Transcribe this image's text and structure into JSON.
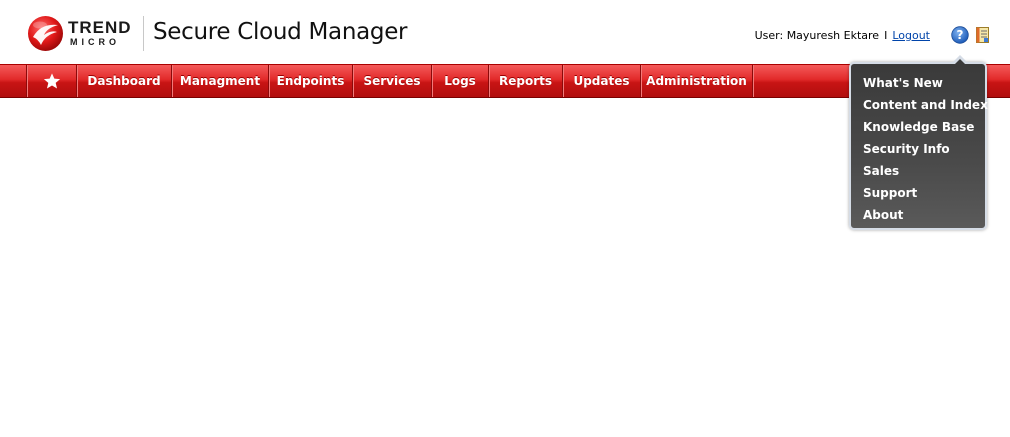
{
  "brand": {
    "logo_trend": "TREND",
    "logo_micro": "MICRO",
    "product_title": "Secure Cloud Manager"
  },
  "user": {
    "label": "User: Mayuresh Ektare",
    "separator": "I",
    "logout_label": "Logout"
  },
  "icons": {
    "help": "help-icon",
    "docs": "document-icon",
    "home": "star-icon"
  },
  "nav": {
    "items": [
      {
        "label": "Dashboard"
      },
      {
        "label": "Managment"
      },
      {
        "label": "Endpoints"
      },
      {
        "label": "Services"
      },
      {
        "label": "Logs"
      },
      {
        "label": "Reports"
      },
      {
        "label": "Updates"
      },
      {
        "label": "Administration"
      }
    ]
  },
  "help_menu": {
    "items": [
      {
        "label": "What's New"
      },
      {
        "label": "Content and Index"
      },
      {
        "label": "Knowledge Base"
      },
      {
        "label": "Security Info"
      },
      {
        "label": "Sales"
      },
      {
        "label": "Support"
      },
      {
        "label": "About"
      }
    ]
  },
  "colors": {
    "nav_red": "#d81e1e",
    "menu_dark": "#444444",
    "link_blue": "#0044aa"
  }
}
